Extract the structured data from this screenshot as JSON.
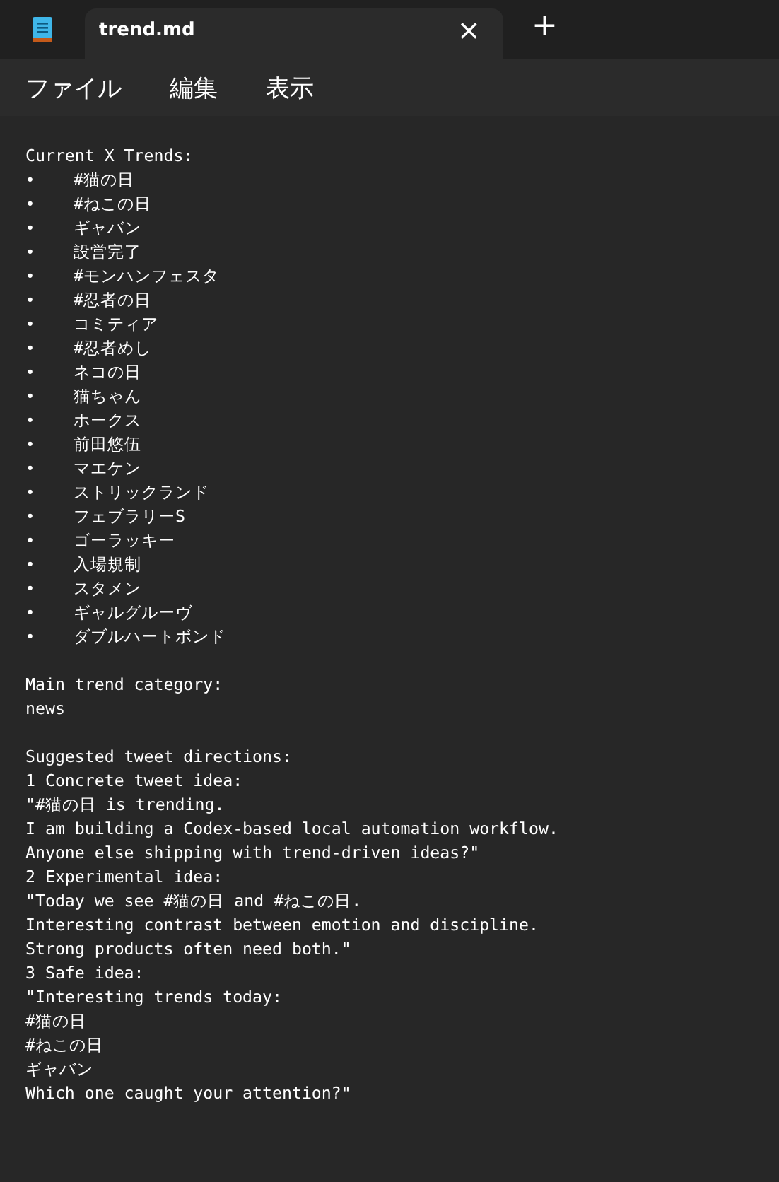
{
  "tabs": [
    {
      "title": "trend.md",
      "selected": true,
      "close": "×"
    }
  ],
  "new_tab": "+",
  "menu": [
    "ファイル",
    "編集",
    "表示"
  ],
  "lines": [
    {
      "kind": "text",
      "text": "Current X Trends:"
    },
    {
      "kind": "bullet",
      "bullet": "•",
      "text": "#猫の日"
    },
    {
      "kind": "bullet",
      "bullet": "•",
      "text": "#ねこの日"
    },
    {
      "kind": "bullet",
      "bullet": "•",
      "text": "ギャバン"
    },
    {
      "kind": "bullet",
      "bullet": "•",
      "text": "設営完了"
    },
    {
      "kind": "bullet",
      "bullet": "•",
      "text": "#モンハンフェスタ"
    },
    {
      "kind": "bullet",
      "bullet": "•",
      "text": "#忍者の日"
    },
    {
      "kind": "bullet",
      "bullet": "•",
      "text": "コミティア"
    },
    {
      "kind": "bullet",
      "bullet": "•",
      "text": "#忍者めし"
    },
    {
      "kind": "bullet",
      "bullet": "•",
      "text": "ネコの日"
    },
    {
      "kind": "bullet",
      "bullet": "•",
      "text": "猫ちゃん"
    },
    {
      "kind": "bullet",
      "bullet": "•",
      "text": "ホークス"
    },
    {
      "kind": "bullet",
      "bullet": "•",
      "text": "前田悠伍"
    },
    {
      "kind": "bullet",
      "bullet": "•",
      "text": "マエケン"
    },
    {
      "kind": "bullet",
      "bullet": "•",
      "text": "ストリックランド"
    },
    {
      "kind": "bullet",
      "bullet": "•",
      "text": "フェブラリーS"
    },
    {
      "kind": "bullet",
      "bullet": "•",
      "text": "ゴーラッキー"
    },
    {
      "kind": "bullet",
      "bullet": "•",
      "text": "入場規制"
    },
    {
      "kind": "bullet",
      "bullet": "•",
      "text": "スタメン"
    },
    {
      "kind": "bullet",
      "bullet": "•",
      "text": "ギャルグルーヴ"
    },
    {
      "kind": "bullet",
      "bullet": "•",
      "text": "ダブルハートボンド"
    },
    {
      "kind": "blank"
    },
    {
      "kind": "text",
      "text": "Main trend category:"
    },
    {
      "kind": "text",
      "text": "news"
    },
    {
      "kind": "blank"
    },
    {
      "kind": "text",
      "text": "Suggested tweet directions:"
    },
    {
      "kind": "text",
      "text": "1 Concrete tweet idea:"
    },
    {
      "kind": "text",
      "text": "\"#猫の日 is trending."
    },
    {
      "kind": "text",
      "text": "I am building a Codex-based local automation workflow."
    },
    {
      "kind": "text",
      "text": "Anyone else shipping with trend-driven ideas?\""
    },
    {
      "kind": "text",
      "text": "2 Experimental idea:"
    },
    {
      "kind": "text",
      "text": "\"Today we see #猫の日 and #ねこの日."
    },
    {
      "kind": "text",
      "text": "Interesting contrast between emotion and discipline."
    },
    {
      "kind": "text",
      "text": "Strong products often need both.\""
    },
    {
      "kind": "text",
      "text": "3 Safe idea:"
    },
    {
      "kind": "text",
      "text": "\"Interesting trends today:"
    },
    {
      "kind": "text",
      "text": "#猫の日"
    },
    {
      "kind": "text",
      "text": "#ねこの日"
    },
    {
      "kind": "text",
      "text": "ギャバン"
    },
    {
      "kind": "text",
      "text": "Which one caught your attention?\""
    }
  ]
}
